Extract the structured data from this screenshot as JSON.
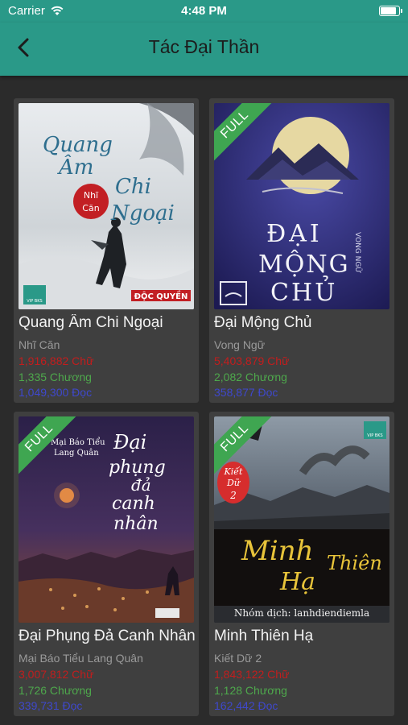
{
  "status_bar": {
    "carrier": "Carrier",
    "time": "4:48 PM",
    "battery_level": 0.92
  },
  "header": {
    "title": "Tác Đại Thần"
  },
  "books": [
    {
      "title": "Quang Âm Chi Ngoại",
      "author": "Nhĩ Căn",
      "words": "1,916,882 Chữ",
      "chapters": "1,335 Chương",
      "reads": "1,049,300 Đọc",
      "full_badge": false,
      "cover_text": [
        "Quang",
        "Âm",
        "Chi",
        "Ngoại",
        "Nhĩ",
        "Căn",
        "ĐỘC QUYỀN",
        "VIP BKS"
      ]
    },
    {
      "title": "Đại Mộng Chủ",
      "author": "Vong Ngữ",
      "words": "5,403,879 Chữ",
      "chapters": "2,082 Chương",
      "reads": "358,877 Đọc",
      "full_badge": true,
      "badge": "FULL",
      "cover_text": [
        "ĐẠI",
        "MỘNG",
        "CHỦ",
        "VONG NGỮ"
      ]
    },
    {
      "title": "Đại Phụng Đả Canh Nhân",
      "author": "Mại Báo Tiểu Lang Quân",
      "words": "3,007,812 Chữ",
      "chapters": "1,726 Chương",
      "reads": "339,731 Đọc",
      "full_badge": true,
      "badge": "FULL",
      "cover_text": [
        "Đại",
        "phụng",
        "đả",
        "canh",
        "nhân",
        "Mại Báo Tiểu",
        "Lang Quân"
      ]
    },
    {
      "title": "Minh Thiên Hạ",
      "author": "Kiết Dữ 2",
      "words": "1,843,122 Chữ",
      "chapters": "1,128 Chương",
      "reads": "162,442 Đọc",
      "full_badge": true,
      "badge": "FULL",
      "cover_text": [
        "Kiết",
        "Dữ",
        "2",
        "Minh",
        "Hạ",
        "Thiên",
        "Nhóm dịch: lanhdiendiemla",
        "VIP BKS"
      ]
    }
  ],
  "icons": {
    "back": "chevron-left-icon",
    "wifi": "wifi-icon",
    "battery": "battery-icon"
  },
  "colors": {
    "primary": "#2a9988",
    "background": "#2b2b2b",
    "card": "#3f3f3f",
    "words": "#c31d1d",
    "chapters": "#4ea84c",
    "reads": "#3f48cc",
    "badge": "#3fa651"
  }
}
